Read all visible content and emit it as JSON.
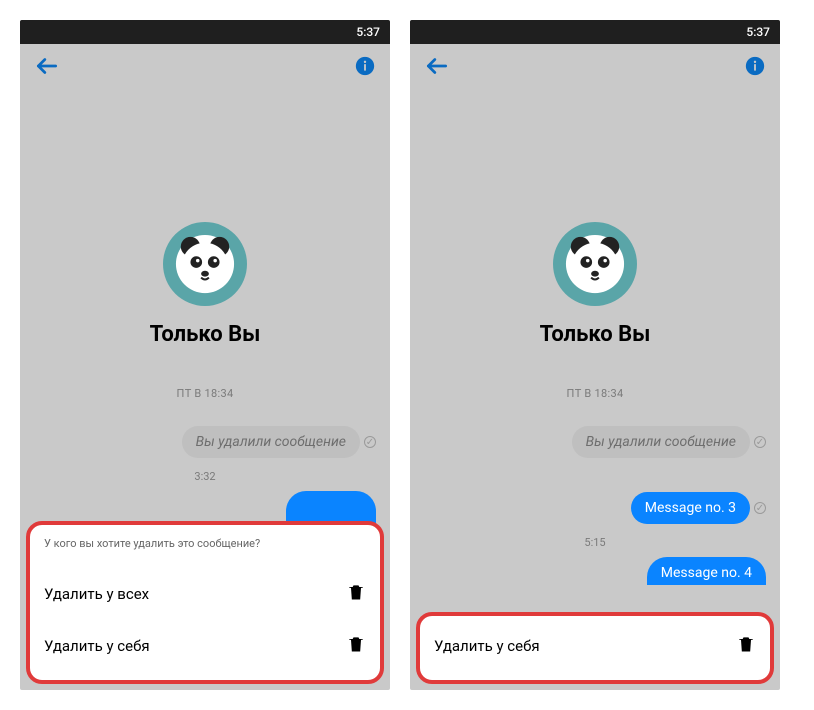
{
  "statusbar": {
    "time": "5:37"
  },
  "contact": {
    "name": "Только Вы"
  },
  "date": "ПТ В 18:34",
  "deleted_bubble": "Вы удалили сообщение",
  "left": {
    "time1": "3:32",
    "sheet_title": "У кого вы хотите удалить это сообщение?",
    "option_all": "Удалить у всех",
    "option_self": "Удалить у себя"
  },
  "right": {
    "msg1": "Message no. 3",
    "time1": "5:15",
    "msg2": "Message no. 4",
    "option_self": "Удалить у себя"
  }
}
